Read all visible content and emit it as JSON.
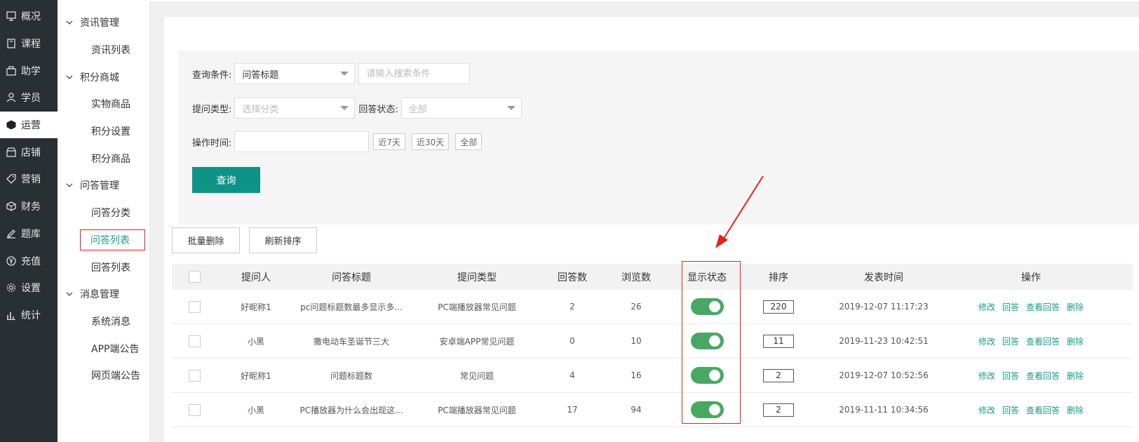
{
  "mainnav": [
    {
      "label": "概况",
      "icon": "monitor-icon"
    },
    {
      "label": "课程",
      "icon": "book-icon"
    },
    {
      "label": "助学",
      "icon": "briefcase-icon"
    },
    {
      "label": "学员",
      "icon": "user-icon"
    },
    {
      "label": "运营",
      "icon": "cube-icon",
      "active": true
    },
    {
      "label": "店铺",
      "icon": "store-icon"
    },
    {
      "label": "营销",
      "icon": "tag-icon"
    },
    {
      "label": "财务",
      "icon": "box-icon"
    },
    {
      "label": "题库",
      "icon": "edit-icon"
    },
    {
      "label": "充值",
      "icon": "yen-icon"
    },
    {
      "label": "设置",
      "icon": "gear-icon"
    },
    {
      "label": "统计",
      "icon": "bar-chart-icon"
    }
  ],
  "subnav": [
    {
      "group": "资讯管理",
      "items": [
        "资讯列表"
      ]
    },
    {
      "group": "积分商城",
      "items": [
        "实物商品",
        "积分设置",
        "积分商品"
      ]
    },
    {
      "group": "问答管理",
      "items": [
        "问答分类",
        "问答列表",
        "回答列表"
      ]
    },
    {
      "group": "消息管理",
      "items": [
        "系统消息",
        "APP端公告",
        "网页端公告"
      ]
    }
  ],
  "filter": {
    "cond_label": "查询条件:",
    "cond_value": "问答标题",
    "search_placeholder": "请输入搜索条件",
    "type_label": "提问类型:",
    "type_placeholder": "选择分类",
    "status_label": "回答状态:",
    "status_value": "全部",
    "time_label": "操作时间:",
    "quick_7": "近7天",
    "quick_30": "近30天",
    "quick_all": "全部",
    "query_button": "查询"
  },
  "actions": {
    "batch_delete": "批量删除",
    "refresh_sort": "刷新排序"
  },
  "table": {
    "headers": [
      "提问人",
      "问答标题",
      "提问类型",
      "回答数",
      "浏览数",
      "显示状态",
      "排序",
      "发表时间",
      "操作"
    ],
    "ops": [
      "修改",
      "回答",
      "查看回答",
      "删除"
    ],
    "rows": [
      {
        "user": "好昵称1",
        "title": "pc问题标题数最多显示多...",
        "type": "PC端播放器常见问题",
        "answers": "2",
        "views": "26",
        "show": true,
        "sort": "220",
        "time": "2019-12-07 11:17:23"
      },
      {
        "user": "小黑",
        "title": "撒电动车圣诞节三大",
        "type": "安卓端APP常见问题",
        "answers": "0",
        "views": "10",
        "show": true,
        "sort": "11",
        "time": "2019-11-23 10:42:51"
      },
      {
        "user": "好昵称1",
        "title": "问题标题数",
        "type": "常见问题",
        "answers": "4",
        "views": "16",
        "show": true,
        "sort": "2",
        "time": "2019-12-07 10:52:56"
      },
      {
        "user": "小黑",
        "title": "PC播放器为什么会出现这...",
        "type": "PC端播放器常见问题",
        "answers": "17",
        "views": "94",
        "show": true,
        "sort": "2",
        "time": "2019-11-11 10:34:56"
      }
    ]
  },
  "colors": {
    "accent": "#0f9386",
    "highlight": "#e2231a",
    "toggle_on": "#49a764",
    "sidebar_bg": "#283033"
  }
}
